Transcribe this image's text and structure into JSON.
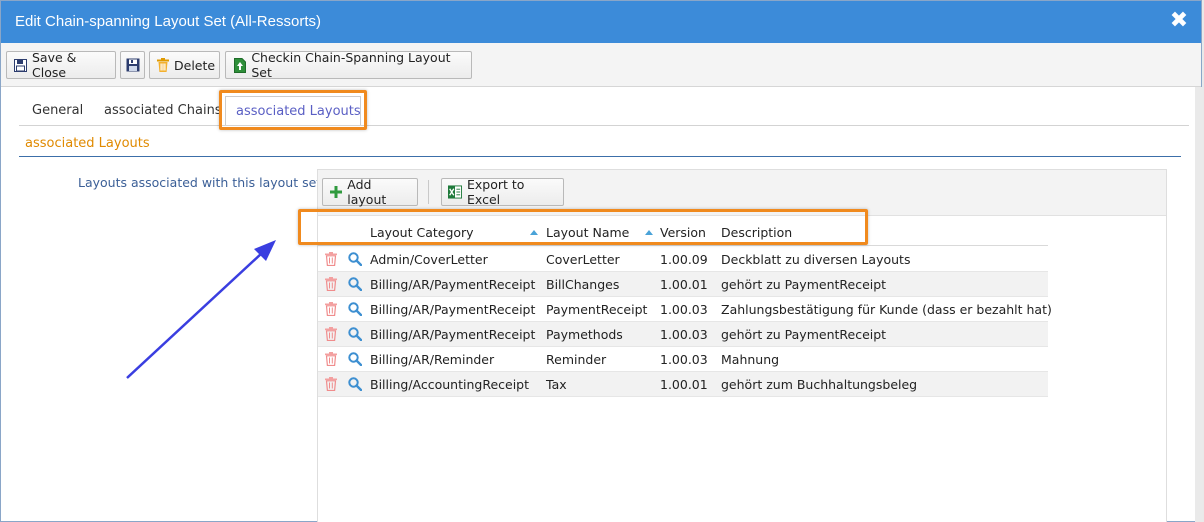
{
  "window": {
    "title": "Edit Chain-spanning Layout Set (All-Ressorts)",
    "close_glyph": "✖"
  },
  "toolbar": {
    "save_close": "Save & Close",
    "delete": "Delete",
    "checkin": "Checkin Chain-Spanning Layout Set"
  },
  "tabs": [
    {
      "label": "General"
    },
    {
      "label": "associated Chains"
    },
    {
      "label": "associated Layouts",
      "active": true
    }
  ],
  "section": {
    "title": "associated Layouts"
  },
  "field": {
    "label": "Layouts associated with this layout set"
  },
  "grid_toolbar": {
    "add": "Add layout",
    "export": "Export to Excel"
  },
  "grid": {
    "columns": [
      "Layout Category",
      "Layout Name",
      "Version",
      "Description"
    ],
    "rows": [
      {
        "category": "Admin/CoverLetter",
        "name": "CoverLetter",
        "version": "1.00.09",
        "description": "Deckblatt zu diversen Layouts"
      },
      {
        "category": "Billing/AR/PaymentReceipt",
        "name": "BillChanges",
        "version": "1.00.01",
        "description": "gehört zu PaymentReceipt"
      },
      {
        "category": "Billing/AR/PaymentReceipt",
        "name": "PaymentReceipt",
        "version": "1.00.03",
        "description": "Zahlungsbestätigung für Kunde (dass er bezahlt hat)"
      },
      {
        "category": "Billing/AR/PaymentReceipt",
        "name": "Paymethods",
        "version": "1.00.03",
        "description": "gehört zu PaymentReceipt"
      },
      {
        "category": "Billing/AR/Reminder",
        "name": "Reminder",
        "version": "1.00.03",
        "description": "Mahnung"
      },
      {
        "category": "Billing/AccountingReceipt",
        "name": "Tax",
        "version": "1.00.01",
        "description": "gehört zum Buchhaltungsbeleg"
      }
    ]
  },
  "colors": {
    "titlebar": "#3c8bd9",
    "accent_orange": "#f08a1e",
    "section_title": "#e08a00",
    "active_tab": "#5a5fc4",
    "annotation_arrow": "#3a3ee0",
    "sort_arrow": "#4aa3d8"
  },
  "icons": {
    "save_close": "floppy-disk-icon",
    "save": "save-icon",
    "delete": "trash-icon",
    "checkin": "checkin-icon",
    "add": "plus-icon",
    "export": "excel-icon",
    "row_delete": "trash-icon",
    "row_view": "magnifier-icon"
  }
}
